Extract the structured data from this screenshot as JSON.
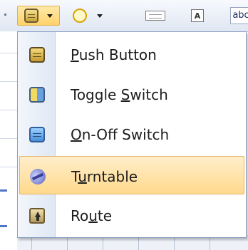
{
  "toolbar": {
    "buttons": [
      {
        "icon": "push-button-icon",
        "has_dropdown": true,
        "active": true
      },
      {
        "icon": "circle-icon",
        "has_dropdown": true
      },
      {
        "icon": "text-field-icon"
      },
      {
        "icon": "label-icon",
        "text": "A"
      },
      {
        "icon": "text-button",
        "text": "abc"
      }
    ]
  },
  "menu": {
    "items": [
      {
        "pre": "",
        "mnemonic": "P",
        "post": "ush Button",
        "icon": "push-button-icon"
      },
      {
        "pre": "Toggle ",
        "mnemonic": "S",
        "post": "witch",
        "icon": "toggle-switch-icon"
      },
      {
        "pre": "",
        "mnemonic": "O",
        "post": "n-Off Switch",
        "icon": "on-off-switch-icon"
      },
      {
        "pre": "T",
        "mnemonic": "u",
        "post": "rntable",
        "icon": "turntable-icon",
        "highlighted": true
      },
      {
        "pre": "Ro",
        "mnemonic": "u",
        "post": "te",
        "icon": "route-icon"
      }
    ]
  },
  "colors": {
    "highlight": "#ffd98c",
    "menu_border": "#8aa0c4"
  }
}
